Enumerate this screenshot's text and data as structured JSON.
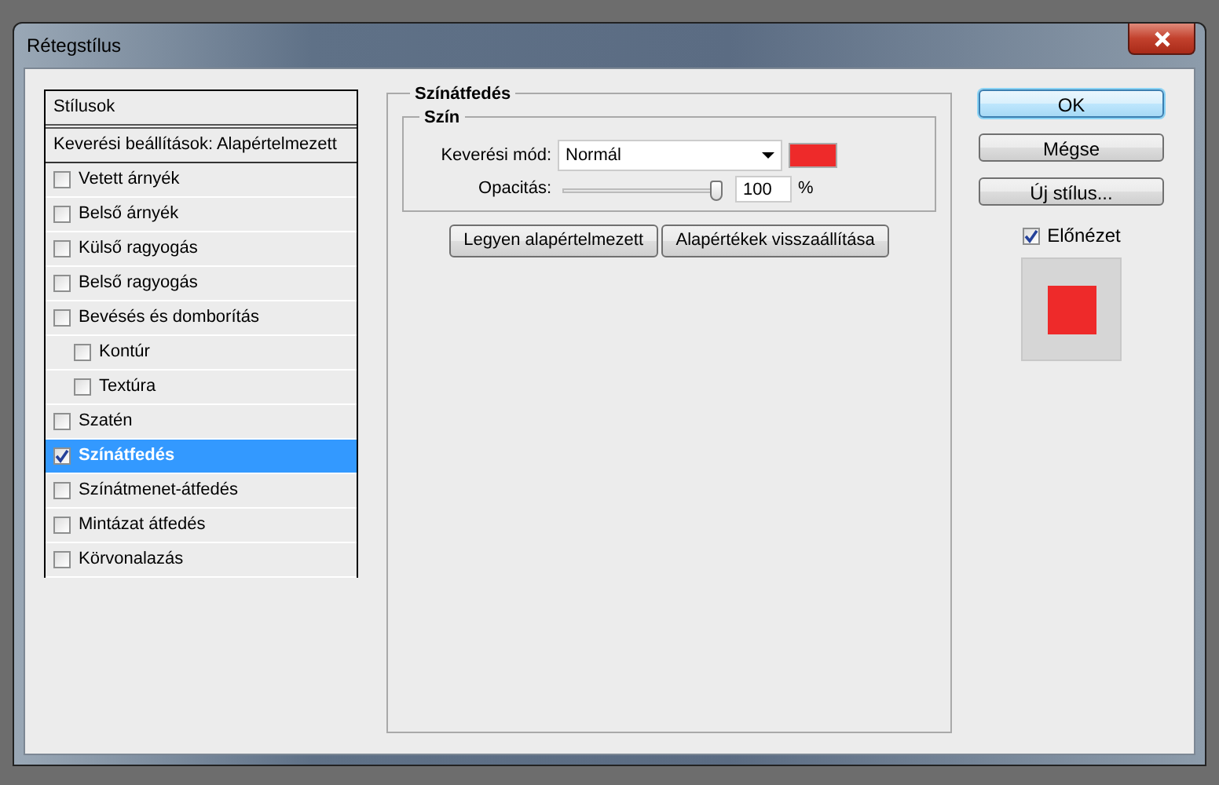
{
  "window": {
    "title": "Rétegstílus"
  },
  "styles_list": {
    "header": "Stílusok",
    "blend_options": "Keverési beállítások: Alapértelmezett",
    "items": [
      {
        "label": "Vetett árnyék",
        "checked": false,
        "selected": false
      },
      {
        "label": "Belső árnyék",
        "checked": false,
        "selected": false
      },
      {
        "label": "Külső ragyogás",
        "checked": false,
        "selected": false
      },
      {
        "label": "Belső ragyogás",
        "checked": false,
        "selected": false
      },
      {
        "label": "Bevésés és domborítás",
        "checked": false,
        "selected": false,
        "children": [
          {
            "label": "Kontúr",
            "checked": false,
            "selected": false
          },
          {
            "label": "Textúra",
            "checked": false,
            "selected": false
          }
        ]
      },
      {
        "label": "Szatén",
        "checked": false,
        "selected": false
      },
      {
        "label": "Színátfedés",
        "checked": true,
        "selected": true
      },
      {
        "label": "Színátmenet-átfedés",
        "checked": false,
        "selected": false
      },
      {
        "label": "Mintázat átfedés",
        "checked": false,
        "selected": false
      },
      {
        "label": "Körvonalazás",
        "checked": false,
        "selected": false
      }
    ]
  },
  "panel": {
    "title": "Színátfedés",
    "group_title": "Szín",
    "blend_mode_label": "Keverési mód:",
    "blend_mode": "Normál",
    "color": "#ee2a2a",
    "opacity_label": "Opacitás:",
    "opacity": {
      "level": 1,
      "value": "100",
      "unit": "%"
    },
    "buttons": [
      "Legyen alapértelmezett",
      "Alapértékek visszaállítása"
    ]
  },
  "actions": [
    {
      "label": "OK",
      "default": true
    },
    {
      "label": "Mégse",
      "default": false
    },
    {
      "label": "Új stílus...",
      "default": false
    }
  ],
  "preview": {
    "label": "Előnézet",
    "checked": true
  }
}
